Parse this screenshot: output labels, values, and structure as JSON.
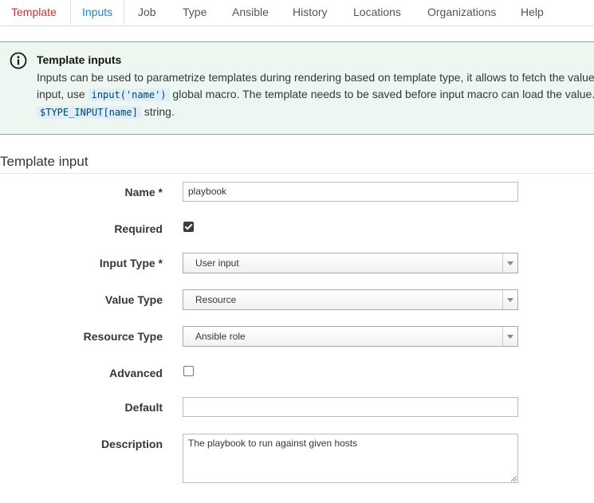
{
  "tabs": [
    "Template",
    "Inputs",
    "Job",
    "Type",
    "Ansible",
    "History",
    "Locations",
    "Organizations",
    "Help"
  ],
  "alert": {
    "title": "Template inputs",
    "text_1": "Inputs can be used to parametrize templates during rendering based on template type, it allows to fetch the value",
    "text_2a": "input, use",
    "code_1": "input('name')",
    "text_2b": "global macro. The template needs to be saved before input macro can load the value. I",
    "code_2": "$TYPE_INPUT[name]",
    "text_3": "string."
  },
  "section_title": "Template input",
  "form": {
    "name_label": "Name *",
    "name_value": "playbook",
    "required_label": "Required",
    "required_checked": true,
    "input_type_label": "Input Type *",
    "input_type_value": "User input",
    "value_type_label": "Value Type",
    "value_type_value": "Resource",
    "resource_type_label": "Resource Type",
    "resource_type_value": "Ansible role",
    "advanced_label": "Advanced",
    "advanced_checked": false,
    "default_label": "Default",
    "default_value": "",
    "description_label": "Description",
    "description_value": "The playbook to run against given hosts"
  },
  "colors": {
    "active_tab": "#1c84c6",
    "first_tab": "#c4322c",
    "alert_bg": "#eef6f2"
  },
  "icons": {
    "alert": "info-circle-icon",
    "select": "triangle-down-icon",
    "resize": "resize-grip-icon"
  }
}
